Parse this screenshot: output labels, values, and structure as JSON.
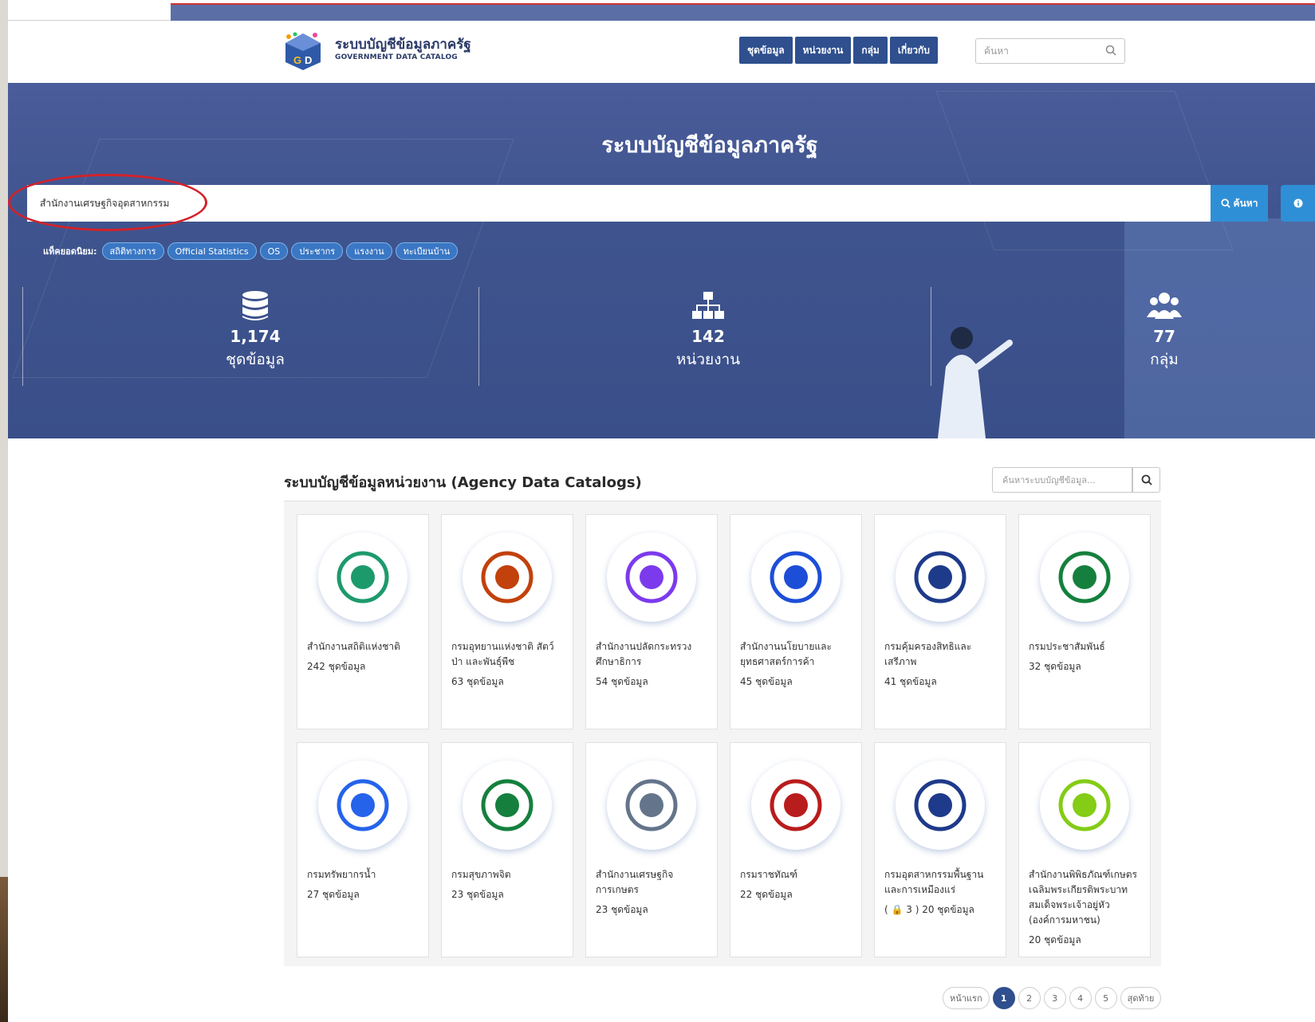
{
  "header": {
    "brand_th": "ระบบบัญชีข้อมูลภาครัฐ",
    "brand_en": "GOVERNMENT DATA CATALOG",
    "nav": [
      "ชุดข้อมูล",
      "หน่วยงาน",
      "กลุ่ม",
      "เกี่ยวกับ"
    ],
    "search_placeholder": "ค้นหา"
  },
  "hero": {
    "title": "ระบบบัญชีข้อมูลภาครัฐ",
    "search_value": "สำนักงานเศรษฐกิจอุตสาหกรรม",
    "search_button": "ค้นหา",
    "tags_label": "แท็คยอดนิยม:",
    "tags": [
      "สถิติทางการ",
      "Official Statistics",
      "OS",
      "ประชากร",
      "แรงงาน",
      "ทะเบียนบ้าน"
    ],
    "stats": [
      {
        "value": "1,174",
        "label": "ชุดข้อมูล",
        "icon": "database-icon"
      },
      {
        "value": "142",
        "label": "หน่วยงาน",
        "icon": "org-chart-icon"
      },
      {
        "value": "77",
        "label": "กลุ่ม",
        "icon": "users-icon"
      }
    ]
  },
  "catalogs": {
    "title": "ระบบบัญชีข้อมูลหน่วยงาน (Agency Data Catalogs)",
    "search_placeholder": "ค้นหาระบบบัญชีข้อมูล...",
    "items": [
      {
        "name": "สำนักงานสถิติแห่งชาติ",
        "count": "242 ชุดข้อมูล",
        "color": "#1d9a6c"
      },
      {
        "name": "กรมอุทยานแห่งชาติ สัตว์ป่า และพันธุ์พืช",
        "count": "63 ชุดข้อมูล",
        "color": "#c2410c"
      },
      {
        "name": "สำนักงานปลัดกระทรวงศึกษาธิการ",
        "count": "54 ชุดข้อมูล",
        "color": "#7c3aed"
      },
      {
        "name": "สำนักงานนโยบายและยุทธศาสตร์การค้า",
        "count": "45 ชุดข้อมูล",
        "color": "#1d4ed8"
      },
      {
        "name": "กรมคุ้มครองสิทธิและเสรีภาพ",
        "count": "41 ชุดข้อมูล",
        "color": "#1e3a8a"
      },
      {
        "name": "กรมประชาสัมพันธ์",
        "count": "32 ชุดข้อมูล",
        "color": "#15803d"
      },
      {
        "name": "กรมทรัพยากรน้ำ",
        "count": "27 ชุดข้อมูล",
        "color": "#2563eb"
      },
      {
        "name": "กรมสุขภาพจิต",
        "count": "23 ชุดข้อมูล",
        "color": "#15803d"
      },
      {
        "name": "สำนักงานเศรษฐกิจการเกษตร",
        "count": "23 ชุดข้อมูล",
        "color": "#64748b"
      },
      {
        "name": "กรมราชทัณฑ์",
        "count": "22 ชุดข้อมูล",
        "color": "#b91c1c"
      },
      {
        "name": "กรมอุตสาหกรรมพื้นฐานและการเหมืองแร่",
        "count": "( 🔒 3 ) 20 ชุดข้อมูล",
        "color": "#1e3a8a"
      },
      {
        "name": "สำนักงานพิพิธภัณฑ์เกษตรเฉลิมพระเกียรติพระบาทสมเด็จพระเจ้าอยู่หัว (องค์การมหาชน)",
        "count": "20 ชุดข้อมูล",
        "color": "#84cc16"
      }
    ]
  },
  "pager": {
    "prev": "หน้าแรก",
    "pages": [
      "1",
      "2",
      "3",
      "4",
      "5"
    ],
    "next": "สุดท้าย",
    "active": "1"
  }
}
